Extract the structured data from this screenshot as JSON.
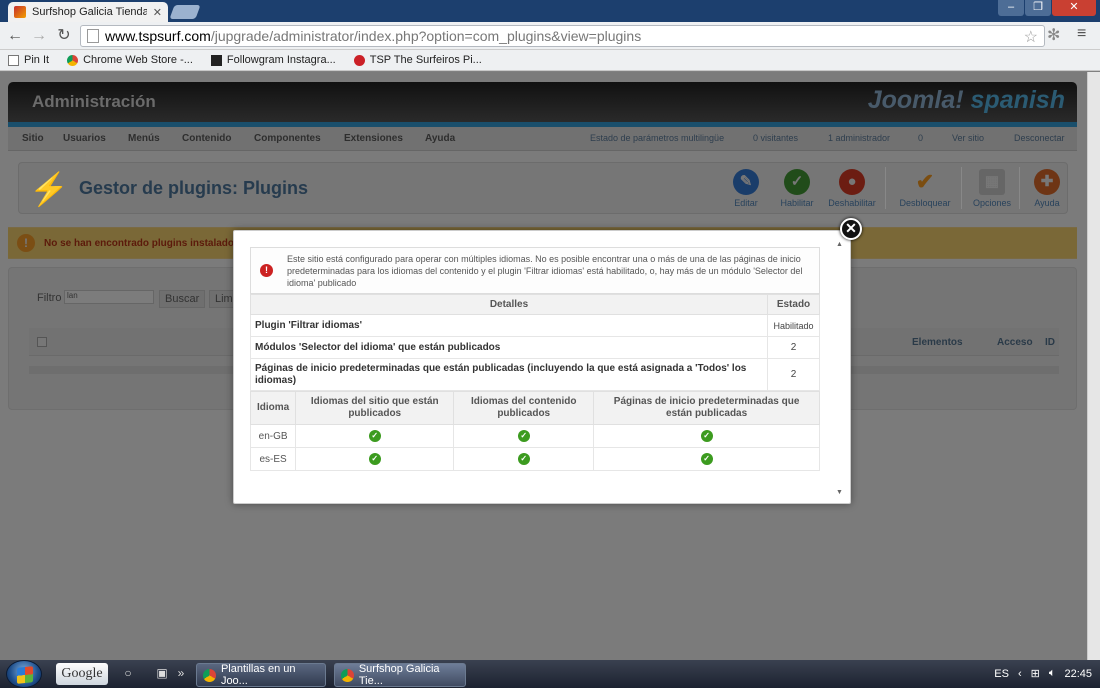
{
  "browser": {
    "tab_title": "Surfshop Galicia Tienda ca",
    "tab_close": "✕",
    "url_host": "www.tspsurf.com",
    "url_path": "/jupgrade/administrator/index.php?option=com_plugins&view=plugins",
    "bookmarks": [
      "Pin It",
      "Chrome Web Store -...",
      "Followgram Instagra...",
      "TSP The Surfeiros Pi..."
    ]
  },
  "header": {
    "title": "Administración",
    "logo_a": "Joomla!",
    "logo_b": "spanish"
  },
  "menu": {
    "items": [
      "Sitio",
      "Usuarios",
      "Menús",
      "Contenido",
      "Componentes",
      "Extensiones",
      "Ayuda"
    ],
    "status": {
      "multilang": "Estado de parámetros multilingüe",
      "visitors": "0 visitantes",
      "admins": "1 administrador",
      "messages": "0",
      "view_site": "Ver sitio",
      "logout": "Desconectar"
    }
  },
  "toolbar": {
    "title": "Gestor de plugins: Plugins",
    "edit": "Editar",
    "enable": "Habilitar",
    "disable": "Deshabilitar",
    "unlock": "Desbloquear",
    "options": "Opciones",
    "help": "Ayuda"
  },
  "warning": {
    "text": "No se han encontrado plugins instalado"
  },
  "filter": {
    "label": "Filtro",
    "value": "lan",
    "search_button": "Buscar",
    "clear_button": "Lim"
  },
  "list": {
    "col_elements": "Elementos",
    "col_access": "Acceso",
    "col_id": "ID"
  },
  "modal": {
    "message": "Este sitio está configurado para operar con múltiples idiomas. No es posible encontrar una o más de una de las páginas de inicio predeterminadas para los idiomas del contenido y el plugin 'Filtrar idiomas' está habilitado, o, hay más de un módulo 'Selector del idioma' publicado",
    "details_header": "Detalles",
    "status_header": "Estado",
    "rows": [
      {
        "label": "Plugin 'Filtrar idiomas'",
        "value": "Habilitado"
      },
      {
        "label": "Módulos 'Selector del idioma' que están publicados",
        "value": "2"
      },
      {
        "label": "Páginas de inicio predeterminadas que están publicadas (incluyendo la que está asignada a 'Todos' los idiomas)",
        "value": "2"
      }
    ],
    "lang_headers": {
      "language": "Idioma",
      "site": "Idiomas del sitio que están publicados",
      "content": "Idiomas del contenido publicados",
      "home": "Páginas de inicio predeterminadas que están publicadas"
    },
    "languages": [
      {
        "code": "en-GB",
        "site": true,
        "content": true,
        "home": true
      },
      {
        "code": "es-ES",
        "site": true,
        "content": true,
        "home": true
      }
    ]
  },
  "taskbar": {
    "google": "Google",
    "tasks": [
      "Plantillas en un Joo...",
      "Surfshop Galicia Tie..."
    ],
    "lang": "ES",
    "time": "22:45"
  }
}
